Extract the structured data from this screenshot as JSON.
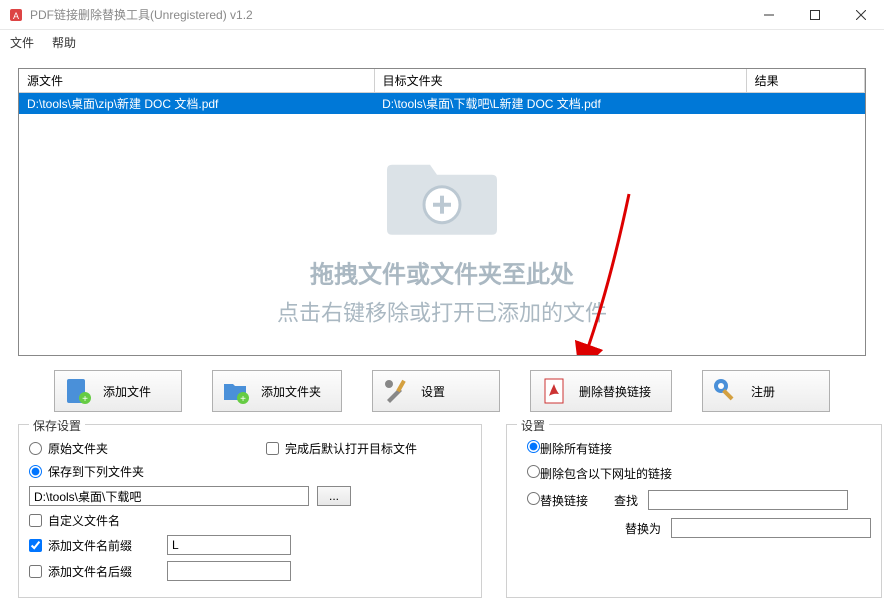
{
  "window": {
    "title": "PDF链接删除替换工具(Unregistered) v1.2"
  },
  "menu": {
    "file": "文件",
    "help": "帮助"
  },
  "table": {
    "headers": {
      "source": "源文件",
      "target": "目标文件夹",
      "result": "结果"
    },
    "rows": [
      {
        "source": "D:\\tools\\桌面\\zip\\新建 DOC 文档.pdf",
        "target": "D:\\tools\\桌面\\下载吧\\L新建 DOC 文档.pdf",
        "result": ""
      }
    ]
  },
  "drop": {
    "line1": "拖拽文件或文件夹至此处",
    "line2": "点击右键移除或打开已添加的文件"
  },
  "toolbar": {
    "add_file": "添加文件",
    "add_folder": "添加文件夹",
    "settings": "设置",
    "remove_replace": "删除替换链接",
    "register": "注册"
  },
  "save": {
    "legend": "保存设置",
    "open_target": "完成后默认打开目标文件",
    "original_folder": "原始文件夹",
    "save_to_folder": "保存到下列文件夹",
    "path": "D:\\tools\\桌面\\下载吧",
    "browse": "...",
    "custom_name": "自定义文件名",
    "add_prefix": "添加文件名前缀",
    "prefix_value": "L",
    "add_suffix": "添加文件名后缀",
    "suffix_value": ""
  },
  "settings": {
    "legend": "设置",
    "remove_all": "删除所有链接",
    "remove_urls": "删除包含以下网址的链接",
    "replace_link": "替换链接",
    "find_label": "查找",
    "find_value": "",
    "replace_label": "替换为",
    "replace_value": ""
  }
}
